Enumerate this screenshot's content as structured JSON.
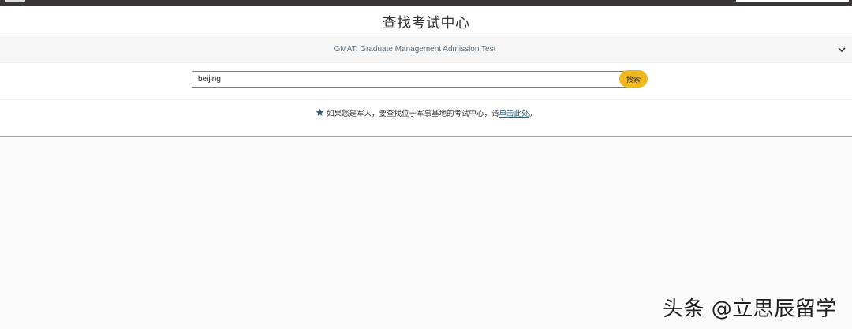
{
  "page": {
    "title": "查找考试中心"
  },
  "exam_selector": {
    "selected": "GMAT: Graduate Management Admission Test"
  },
  "search": {
    "value": "beijing",
    "button_label": "搜索"
  },
  "notice": {
    "text": "如果您是军人，要查找位于军事基地的考试中心，请",
    "link_text": "单击此处",
    "suffix": "。"
  },
  "watermark": {
    "text": "头条 @立思辰留学"
  },
  "icons": {
    "notice": "star-icon",
    "selector": "chevron-down-icon"
  },
  "colors": {
    "accent": "#efb81f",
    "star": "#2f5f77",
    "link": "#2f5f77",
    "topbar": "#3a3636"
  }
}
